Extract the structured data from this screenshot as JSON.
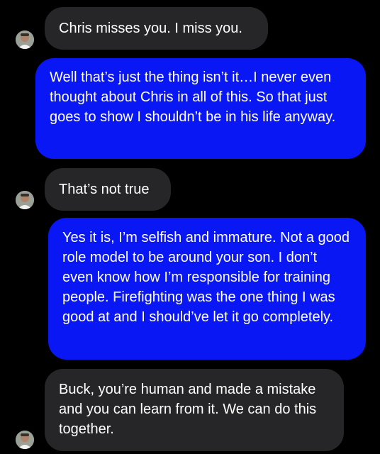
{
  "colors": {
    "background": "#000000",
    "incoming_bubble": "#262628",
    "outgoing_bubble": "#0a17f5",
    "text": "#ffffff"
  },
  "messages": [
    {
      "direction": "incoming",
      "text": "Chris misses you.  I miss you.",
      "avatar_icon": "contact-avatar-icon"
    },
    {
      "direction": "outgoing",
      "text": "Well that’s just the thing isn’t it…I never even thought about Chris in all of this. So that just goes to show I shouldn’t be in his life anyway."
    },
    {
      "direction": "incoming",
      "text": "That’s not true",
      "avatar_icon": "contact-avatar-icon"
    },
    {
      "direction": "outgoing",
      "text": "Yes it is, I’m selfish and immature. Not a good role model to be around your son. I don’t even know how I’m responsible for training people. Firefighting was the one thing I was good at and I should’ve let it go completely."
    },
    {
      "direction": "incoming",
      "text": "Buck, you’re human and made a mistake and you can learn from it. We can do this together.",
      "avatar_icon": "contact-avatar-icon"
    }
  ]
}
